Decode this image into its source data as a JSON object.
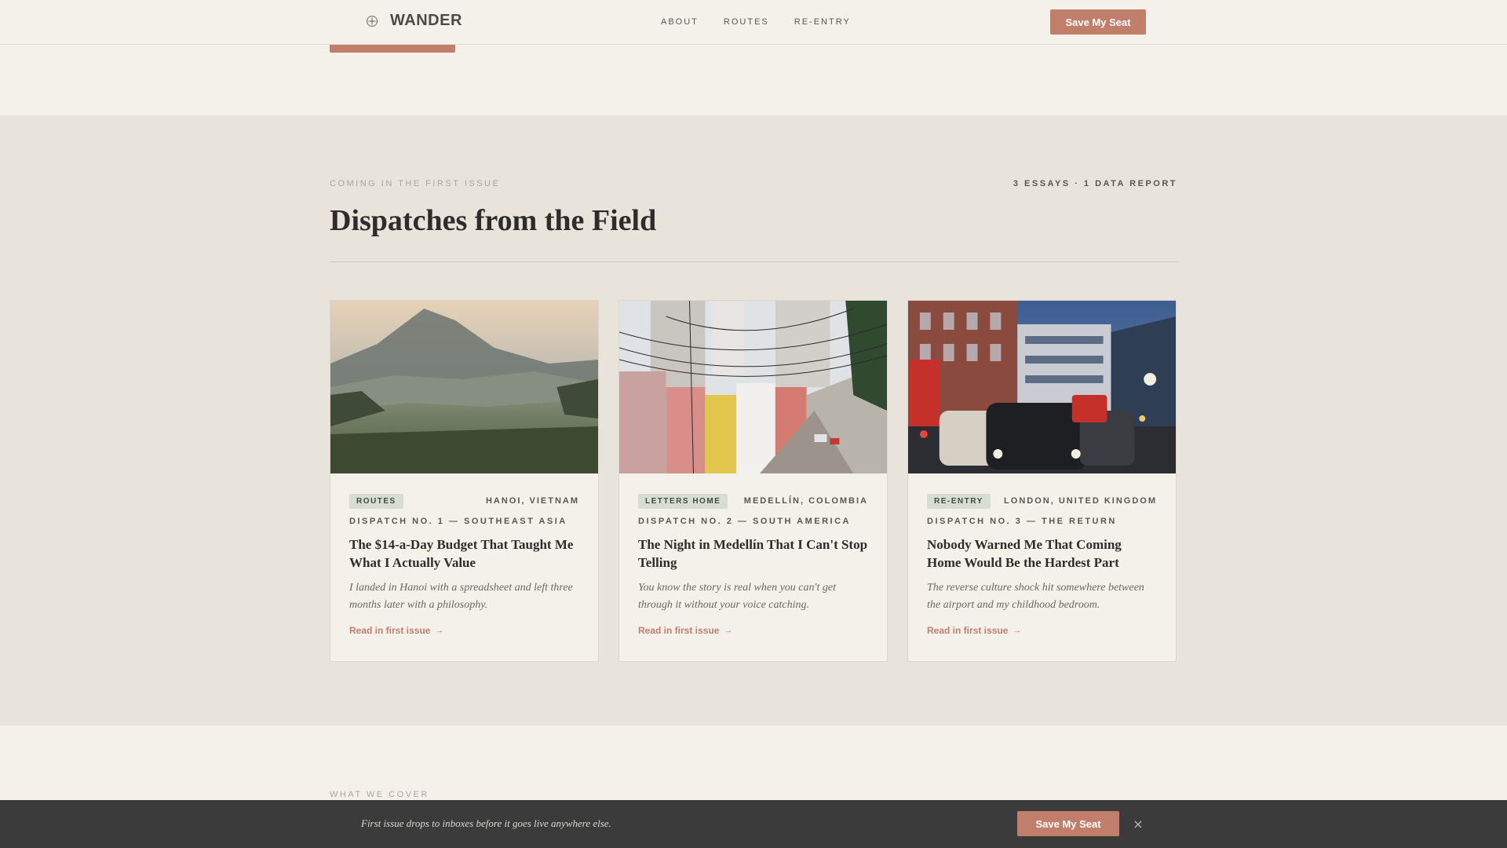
{
  "header": {
    "brand": "WANDER",
    "nav": [
      "ABOUT",
      "ROUTES",
      "RE-ENTRY"
    ],
    "cta": "Save My Seat"
  },
  "dispatches": {
    "eyebrow": "COMING IN THE FIRST ISSUE",
    "count": "3 ESSAYS · 1 DATA REPORT",
    "title": "Dispatches from the Field",
    "cards": [
      {
        "tag": "ROUTES",
        "location": "HANOI, VIETNAM",
        "dispatch": "DISPATCH NO. 1 — SOUTHEAST ASIA",
        "title": "The $14-a-Day Budget That Taught Me What I Actually Value",
        "excerpt": "I landed in Hanoi with a spreadsheet and left three months later with a philosophy.",
        "link": "Read in first issue",
        "image": "mountain-valley-photo"
      },
      {
        "tag": "LETTERS HOME",
        "location": "MEDELLÍN, COLOMBIA",
        "dispatch": "DISPATCH NO. 2 — SOUTH AMERICA",
        "title": "The Night in Medellín That I Can't Stop Telling",
        "excerpt": "You know the story is real when you can't get through it without your voice catching.",
        "link": "Read in first issue",
        "image": "city-street-photo"
      },
      {
        "tag": "RE-ENTRY",
        "location": "LONDON, UNITED KINGDOM",
        "dispatch": "DISPATCH NO. 3 — THE RETURN",
        "title": "Nobody Warned Me That Coming Home Would Be the Hardest Part",
        "excerpt": "The reverse culture shock hit somewhere between the airport and my childhood bedroom.",
        "link": "Read in first issue",
        "image": "london-traffic-photo"
      }
    ]
  },
  "lower": {
    "eyebrow": "WHAT WE COVER"
  },
  "banner": {
    "text": "First issue drops to inboxes before it goes live anywhere else.",
    "cta": "Save My Seat",
    "close": "×"
  },
  "colors": {
    "accent": "#c17f6b",
    "section_bg": "#e8e4dc",
    "page_bg": "#f4f1eb",
    "banner_bg": "#3b3b3b"
  },
  "icons": {
    "brand": "compass-icon",
    "link_arrow": "arrow-right-icon",
    "close": "close-icon"
  }
}
